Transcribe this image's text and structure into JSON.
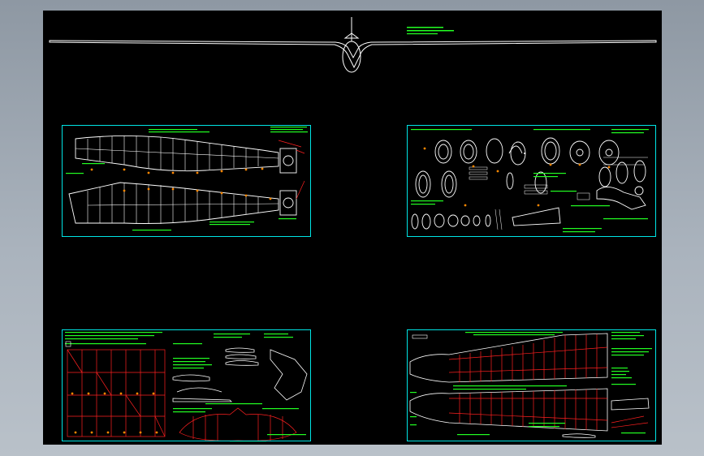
{
  "colors": {
    "background": "#000000",
    "frame_outer": "#a4adb6",
    "sheet_border": "#00e5e5",
    "outline_white": "#ffffff",
    "note_green": "#22ff22",
    "structure_red": "#ff2020",
    "marker_orange": "#ff8800"
  },
  "sheets": [
    {
      "id": "wing-planform",
      "description_icon": "wing-ribs-icon"
    },
    {
      "id": "fuselage-formers",
      "description_icon": "formers-icon"
    },
    {
      "id": "tail-assembly",
      "description_icon": "tail-ribs-icon"
    },
    {
      "id": "wing-panels",
      "description_icon": "wing-panels-icon"
    }
  ]
}
